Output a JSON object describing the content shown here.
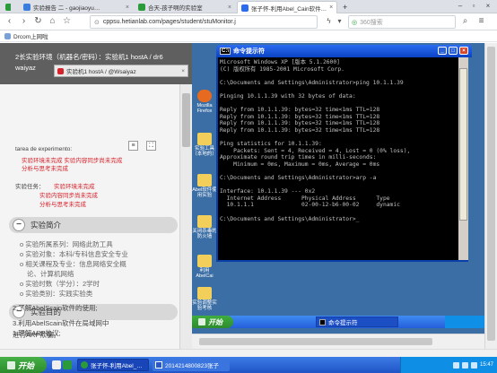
{
  "browser": {
    "tabs": [
      {
        "label": "实验报告 二 - gaojiaoyu…"
      },
      {
        "label": "合天-孩子啊的实验室"
      },
      {
        "label": "张子怀-利用Abel_Cain软件…"
      }
    ],
    "url": "cppsu.hetianlab.com/pages/student/stuMonitor.j",
    "search_placeholder": "360搜索",
    "bookmark": "Drcom上网啦"
  },
  "page": {
    "header_line1": "2长实验环境（机器名/密码）：实验机1  hostA / ",
    "header_suffix": "dr6",
    "header_line2": "waiyaz",
    "vm_tab": "实验机1    hostA / @Wsaiyaz",
    "area_label": "tarea de experimento:",
    "area_items": [
      "实验环境未完成",
      "实验内容同步尚未完成",
      "分析与思考未完成"
    ],
    "task_label": "实验任务：",
    "task_items": [
      "实验环境未完成",
      "实验内容同步尚未完成",
      "分析与思考未完成"
    ],
    "intro_title": "实验简介",
    "intro_items": [
      "o 实验所属系列：网络此防工具",
      "o 实验对象：本科/专科信息安全专业",
      "o 相关课程及专业：信息网络安全概",
      "论、计算机网络",
      "o 实验时数（学分）：2学时",
      "o 实验类别：实践实验类"
    ],
    "goal_title": "实验目的",
    "goal_items": [
      "1.理解ARP协议;",
      "2.了解AbelScain软件的使用;",
      "3.利用AbelScain软件在局域网中",
      "进行ARP欺骗。"
    ]
  },
  "xp": {
    "desktop_icons": [
      "Mozilla Firefox",
      "实验工具（本地的）",
      "Abel软件使用实验",
      "关闭杀毒的防火墙",
      "利用AbelCai",
      "实验调整实验考核"
    ],
    "cmd_title": "命令提示符",
    "cmd_lines": [
      "Microsoft Windows XP [版本 5.1.2600]",
      "(C) 版权所有 1985-2001 Microsoft Corp.",
      "",
      "C:\\Documents and Settings\\Administrator>ping 10.1.1.39",
      "",
      "Pinging 10.1.1.39 with 32 bytes of data:",
      "",
      "Reply from 10.1.1.39: bytes=32 time<1ms TTL=128",
      "Reply from 10.1.1.39: bytes=32 time<1ms TTL=128",
      "Reply from 10.1.1.39: bytes=32 time<1ms TTL=128",
      "Reply from 10.1.1.39: bytes=32 time<1ms TTL=128",
      "",
      "Ping statistics for 10.1.1.39:",
      "    Packets: Sent = 4, Received = 4, Lost = 0 (0% loss),",
      "Approximate round trip times in milli-seconds:",
      "    Minimum = 0ms, Maximum = 0ms, Average = 0ms",
      "",
      "C:\\Documents and Settings\\Administrator>arp -a",
      "",
      "Interface: 10.1.1.39 --- 0x2",
      "  Internet Address      Physical Address      Type",
      "  10.1.1.1              02-00-12-b6-00-02     dynamic",
      "",
      "C:\\Documents and Settings\\Administrator>_"
    ],
    "start_label": "开始",
    "taskbar_item": "命令提示符"
  },
  "host_taskbar": {
    "start_label": "开始",
    "items": [
      "张子怀-利用Abel_…",
      "2014214800823张子"
    ],
    "clock": "15:47"
  },
  "colors": {
    "accent_red": "#d6222a",
    "xp_desktop": "#3a6ea5",
    "xp_title": "#0b43c4"
  }
}
